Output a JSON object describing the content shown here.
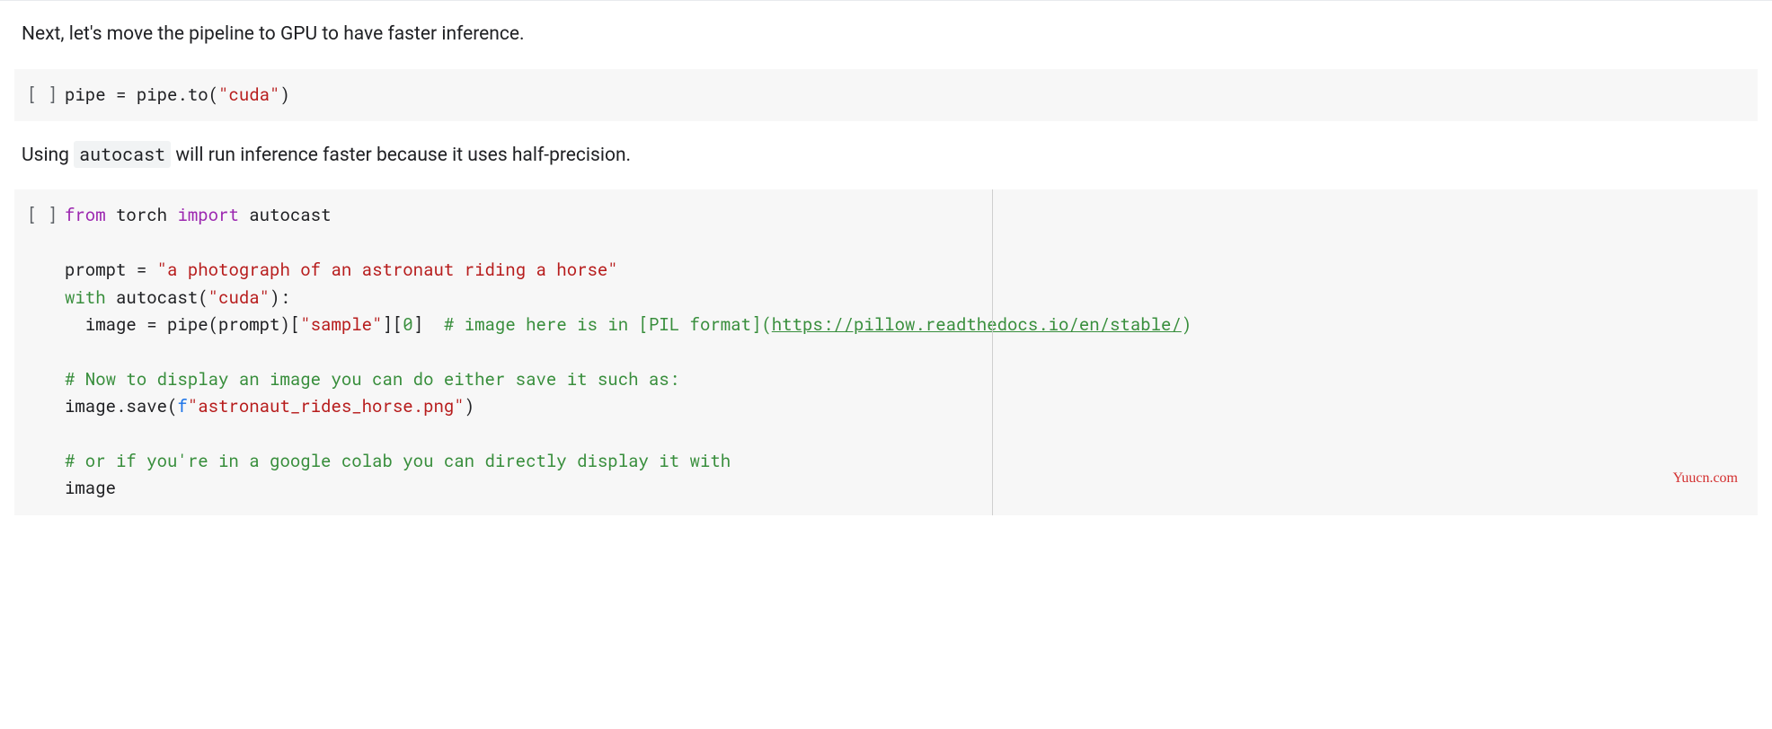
{
  "text1": "Next, let's move the pipeline to GPU to have faster inference.",
  "text2_pre": "Using ",
  "text2_code": "autocast",
  "text2_post": " will run inference faster because it uses half-precision.",
  "cell_gutter": "[ ]",
  "code1": {
    "line1": "pipe = pipe.to(\"cuda\")"
  },
  "code2": {
    "kw_from": "from",
    "mod_torch": " torch ",
    "kw_import": "import",
    "mod_autocast": " autocast",
    "blank": "",
    "l3_a": "prompt = ",
    "l3_str": "\"a photograph of an astronaut riding a horse\"",
    "l4_with": "with",
    "l4_rest": " autocast(",
    "l4_str": "\"cuda\"",
    "l4_close": "):",
    "l5_a": "  image = pipe(prompt)[",
    "l5_str": "\"sample\"",
    "l5_b": "][",
    "l5_num": "0",
    "l5_c": "]  ",
    "l5_comment": "# image here is in [PIL format](",
    "l5_link": "https://pillow.readthedocs.io/en/stable/",
    "l5_comment_end": ")",
    "l7_comment": "# Now to display an image you can do either save it such as:",
    "l8_a": "image.save(",
    "l8_f": "f",
    "l8_str": "\"astronaut_rides_horse.png\"",
    "l8_b": ")",
    "l10_comment": "# or if you're in a google colab you can directly display it with",
    "l11": "image"
  },
  "watermark": "Yuucn.com"
}
